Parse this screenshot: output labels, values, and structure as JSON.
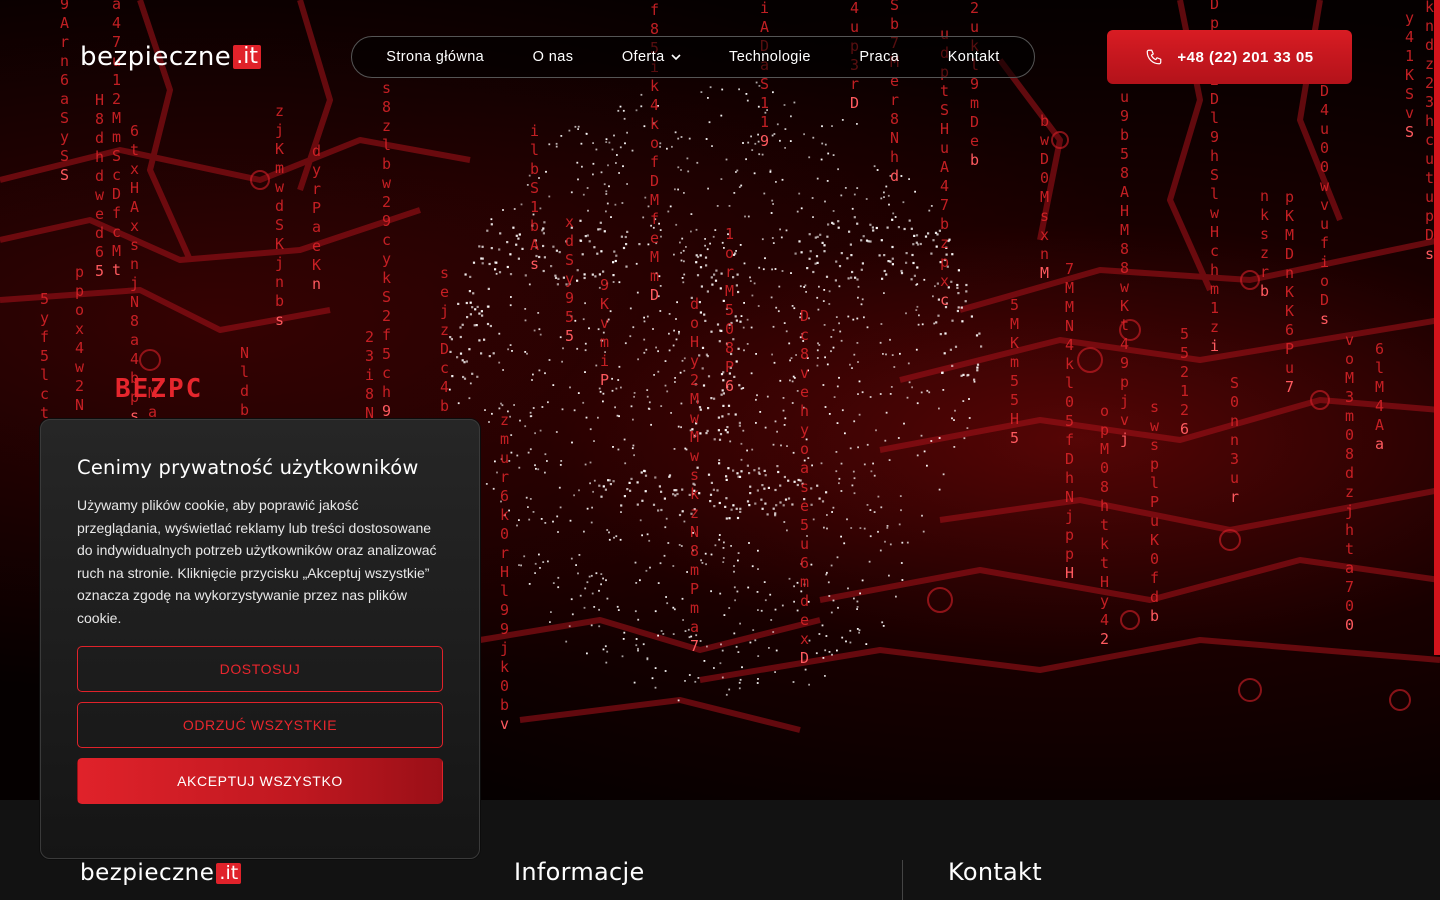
{
  "header": {
    "logo_text": "bezpieczne",
    "logo_suffix": ".it",
    "nav": [
      {
        "label": "Strona główna"
      },
      {
        "label": "O nas"
      },
      {
        "label": "Oferta",
        "has_dropdown": true
      },
      {
        "label": "Technologie"
      },
      {
        "label": "Praca"
      },
      {
        "label": "Kontakt"
      }
    ],
    "phone": {
      "label": "+48 (22) 201 33 05",
      "icon": "phone-icon"
    }
  },
  "hero": {
    "heading_partial": "BEZPC"
  },
  "cookie": {
    "title": "Cenimy prywatność użytkowników",
    "body": "Używamy plików cookie, aby poprawić jakość przeglądania, wyświetlać reklamy lub treści dostosowane do indywidualnych potrzeb użytkowników oraz analizować ruch na stronie. Kliknięcie przycisku „Akceptuj wszystkie” oznacza zgodę na wykorzystywanie przez nas plików cookie.",
    "customize_label": "DOSTOSUJ",
    "reject_label": "ODRZUĆ WSZYSTKIE",
    "accept_label": "AKCEPTUJ WSZYSTKO"
  },
  "footer": {
    "logo_text": "bezpieczne",
    "logo_suffix": ".it",
    "col_info_heading": "Informacje",
    "col_contact_heading": "Kontakt"
  },
  "colors": {
    "accent": "#e0222a",
    "background": "#000000",
    "footer_bg": "#121212"
  }
}
